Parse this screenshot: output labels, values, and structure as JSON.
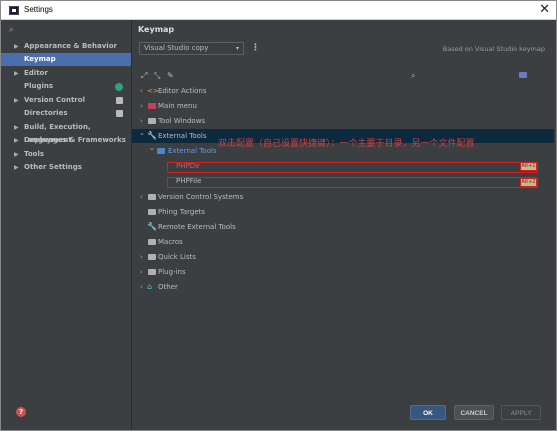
{
  "window": {
    "title": "Settings",
    "close_glyph": "✕"
  },
  "sidebar": {
    "search_icon": "search-icon",
    "items": [
      {
        "label": "Appearance & Behavior",
        "expandable": true
      },
      {
        "label": "Keymap",
        "expandable": false,
        "selected": true
      },
      {
        "label": "Editor",
        "expandable": true
      },
      {
        "label": "Plugins",
        "expandable": false,
        "badge": "update-badge-icon"
      },
      {
        "label": "Version Control",
        "expandable": true,
        "project": true
      },
      {
        "label": "Directories",
        "expandable": false,
        "project": true
      },
      {
        "label": "Build, Execution, Deployment",
        "expandable": true
      },
      {
        "label": "Languages & Frameworks",
        "expandable": true
      },
      {
        "label": "Tools",
        "expandable": true
      },
      {
        "label": "Other Settings",
        "expandable": true
      }
    ],
    "help_glyph": "?"
  },
  "main": {
    "title": "Keymap",
    "keymap_select": {
      "value": "Visual Studio copy",
      "caret": "▾"
    },
    "more_glyph": "⋮",
    "based_on": "Based on Visual Studio keymap",
    "tree": [
      {
        "label": "Editor Actions",
        "chev": "›",
        "icon": "code-icon"
      },
      {
        "label": "Main menu",
        "chev": "›",
        "icon": "menu-icon"
      },
      {
        "label": "Tool Windows",
        "chev": "›",
        "icon": "folder-icon"
      },
      {
        "label": "External Tools",
        "chev": "⌄",
        "icon": "wrench-icon",
        "selected": true
      },
      {
        "label": "External Tools",
        "chev": "⌄",
        "icon": "folder-icon",
        "sub": true
      },
      {
        "label": "PHPDir",
        "leaf": true
      },
      {
        "label": "PHPFile",
        "leaf": true
      },
      {
        "label": "Version Control Systems",
        "chev": "›",
        "icon": "folder-icon"
      },
      {
        "label": "Phing Targets",
        "icon": "phing-icon"
      },
      {
        "label": "Remote External Tools",
        "icon": "wrench-icon"
      },
      {
        "label": "Macros",
        "icon": "folder-icon"
      },
      {
        "label": "Quick Lists",
        "chev": "›",
        "icon": "folder-icon"
      },
      {
        "label": "Plug-ins",
        "chev": "›",
        "icon": "folder-icon"
      },
      {
        "label": "Other",
        "chev": "›",
        "icon": "other-icon"
      }
    ],
    "annotation": "双击配置（自己设置快捷键）：一个主要于目录，另一个文件配置",
    "shortcut_labels": [
      "Alt+1",
      "Alt+2"
    ]
  },
  "buttons": {
    "ok": "OK",
    "cancel": "CANCEL",
    "apply": "APPLY"
  }
}
